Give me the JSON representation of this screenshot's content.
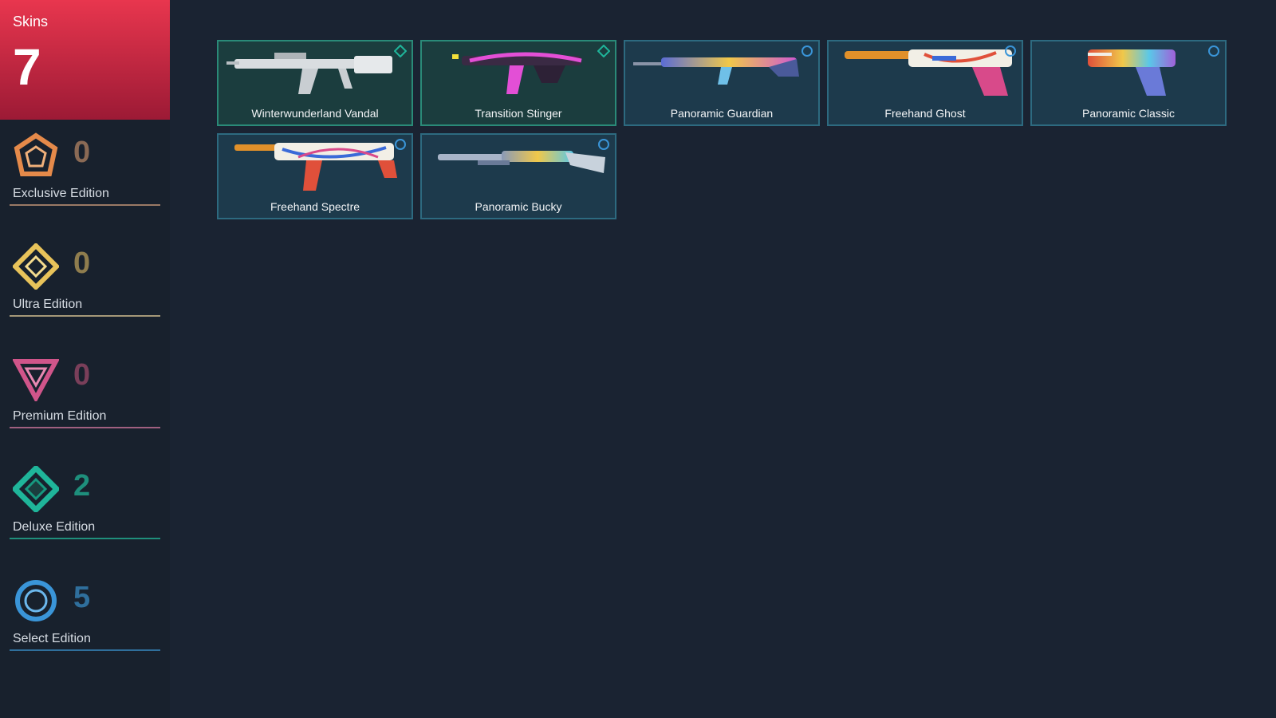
{
  "summary": {
    "label": "Skins",
    "count": "7"
  },
  "tiers": [
    {
      "label": "Exclusive Edition",
      "count": "0",
      "icon": "exclusive-edition-icon",
      "color": "#e58a4a",
      "count_color": "#8a6a55"
    },
    {
      "label": "Ultra Edition",
      "count": "0",
      "icon": "ultra-edition-icon",
      "color": "#e8c35a",
      "count_color": "#8f7d4e"
    },
    {
      "label": "Premium Edition",
      "count": "0",
      "icon": "premium-edition-icon",
      "color": "#d0558a",
      "count_color": "#7a3f5a"
    },
    {
      "label": "Deluxe Edition",
      "count": "2",
      "icon": "deluxe-edition-icon",
      "color": "#1fb59a",
      "count_color": "#1e8f7c"
    },
    {
      "label": "Select Edition",
      "count": "5",
      "icon": "select-edition-icon",
      "color": "#3a95d8",
      "count_color": "#2f6f9c"
    }
  ],
  "skins": [
    {
      "name": "Winterwunderland Vandal",
      "tier": "deluxe",
      "icon": "vandal-icon"
    },
    {
      "name": "Transition Stinger",
      "tier": "deluxe",
      "icon": "stinger-icon"
    },
    {
      "name": "Panoramic Guardian",
      "tier": "select",
      "icon": "guardian-icon"
    },
    {
      "name": "Freehand Ghost",
      "tier": "select",
      "icon": "ghost-icon"
    },
    {
      "name": "Panoramic Classic",
      "tier": "select",
      "icon": "classic-icon"
    },
    {
      "name": "Freehand Spectre",
      "tier": "select",
      "icon": "spectre-icon"
    },
    {
      "name": "Panoramic Bucky",
      "tier": "select",
      "icon": "bucky-icon"
    }
  ]
}
